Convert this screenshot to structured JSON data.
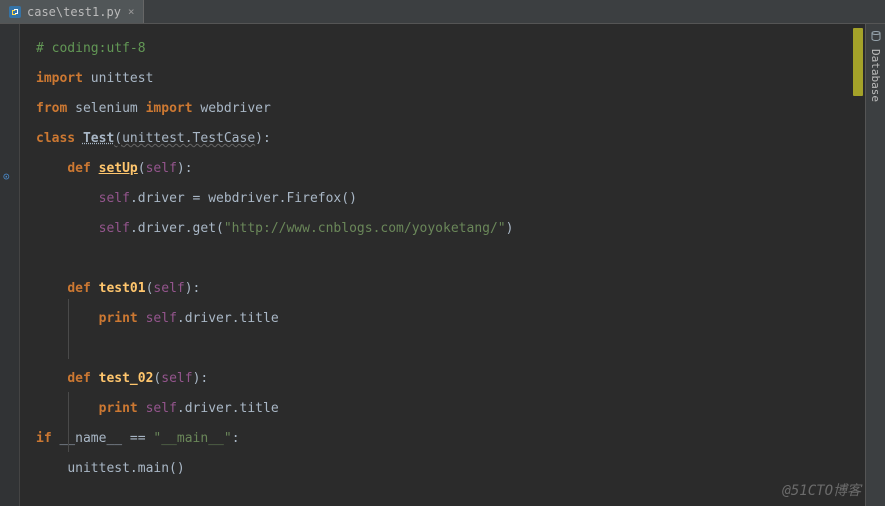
{
  "tab": {
    "filename": "case\\test1.py",
    "close": "×"
  },
  "code": {
    "line1_comment": "# coding:utf-8",
    "line2_kw_import": "import",
    "line2_mod": " unittest",
    "line3_kw_from": "from",
    "line3_mod": " selenium ",
    "line3_kw_import": "import",
    "line3_name": " webdriver",
    "line4_kw_class": "class ",
    "line4_classname": "Test",
    "line4_paren_open": "(",
    "line4_base": "unittest.TestCase",
    "line4_paren_close": "):",
    "line5_indent": "    ",
    "line5_kw_def": "def ",
    "line5_name": "setUp",
    "line5_paren_open": "(",
    "line5_self": "self",
    "line5_paren_close": "):",
    "line6_indent": "        ",
    "line6_self": "self",
    "line6_rest": ".driver = webdriver.Firefox()",
    "line7_indent": "        ",
    "line7_self": "self",
    "line7_part1": ".driver.get(",
    "line7_str": "\"http://www.cnblogs.com/yoyoketang/\"",
    "line7_part2": ")",
    "line8_kw_def": "def ",
    "line8_name": "test01",
    "line8_paren_open": "(",
    "line8_self": "self",
    "line8_paren_close": "):",
    "line9_indent": "        ",
    "line9_kw_print": "print",
    "line9_space": " ",
    "line9_self": "self",
    "line9_rest": ".driver.title",
    "line10_kw_def": "def ",
    "line10_name": "test_02",
    "line10_paren_open": "(",
    "line10_self": "self",
    "line10_paren_close": "):",
    "line11_indent": "        ",
    "line11_kw_print": "print",
    "line11_space": " ",
    "line11_self": "self",
    "line11_rest": ".driver.title",
    "line12_kw_if": "if",
    "line12_space": " ",
    "line12_name": "__name__ == ",
    "line12_str": "\"__main__\"",
    "line12_end": ":",
    "line13_indent": "    ",
    "line13_call": "unittest.main()"
  },
  "sidebar": {
    "database_label": "Database"
  },
  "watermark": "@51CTO博客"
}
